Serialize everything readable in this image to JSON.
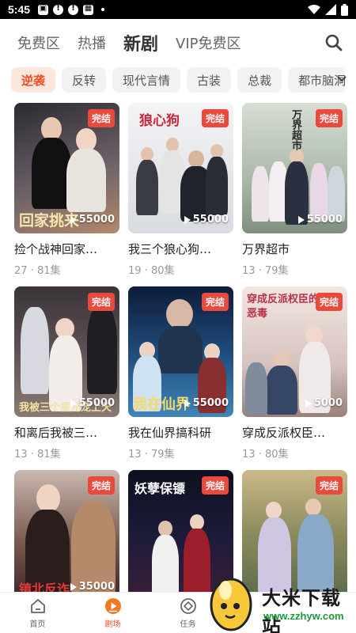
{
  "status": {
    "time": "5:45",
    "icons": [
      "photo-icon",
      "alert-icon",
      "alert-icon",
      "media-icon"
    ],
    "right_icons": [
      "wifi-icon",
      "signal-icon",
      "battery-icon"
    ]
  },
  "tabs": [
    {
      "label": "免费区",
      "active": false
    },
    {
      "label": "热播",
      "active": false
    },
    {
      "label": "新剧",
      "active": true
    },
    {
      "label": "VIP免费区",
      "active": false
    }
  ],
  "chips": [
    "逆袭",
    "反转",
    "现代言情",
    "古装",
    "总裁",
    "都市脑洞"
  ],
  "chips_active_index": 0,
  "colors": {
    "accent": "#f04e23",
    "badge": "#e94a3b",
    "chip_active_bg": "#fde6dc"
  },
  "dramas": [
    {
      "title": "捡个战神回家…",
      "badge": "完结",
      "plays": "55000",
      "views": "27",
      "episodes": "81集",
      "poster_text": "回家挑来"
    },
    {
      "title": "我三个狼心狗…",
      "badge": "完结",
      "plays": "55000",
      "views": "19",
      "episodes": "80集",
      "poster_text": "狼心狗"
    },
    {
      "title": "万界超市",
      "badge": "完结",
      "plays": "55000",
      "views": "13",
      "episodes": "79集",
      "poster_text": "万界超市"
    },
    {
      "title": "和离后我被三…",
      "badge": "完结",
      "plays": "55000",
      "views": "13",
      "episodes": "81集",
      "poster_text": "我被三个皇兄宠上天"
    },
    {
      "title": "我在仙界搞科研",
      "badge": "完结",
      "plays": "55000",
      "views": "13",
      "episodes": "79集",
      "poster_text": "我在仙界"
    },
    {
      "title": "穿成反派权臣…",
      "badge": "完结",
      "plays": "5000",
      "views": "13",
      "episodes": "80集",
      "poster_text": "穿成反派权臣的恶毒"
    },
    {
      "title": "",
      "badge": "完结",
      "plays": "35000",
      "views": "",
      "episodes": "",
      "poster_text": "镇北反诈"
    },
    {
      "title": "",
      "badge": "完结",
      "plays": "",
      "views": "",
      "episodes": "",
      "poster_text": "妖孽保镖"
    },
    {
      "title": "",
      "badge": "完结",
      "plays": "",
      "views": "",
      "episodes": "",
      "poster_text": ""
    }
  ],
  "bottom_nav": [
    {
      "label": "首页",
      "icon": "home-icon",
      "active": false
    },
    {
      "label": "剧场",
      "icon": "theater-play-icon",
      "active": true
    },
    {
      "label": "任务",
      "icon": "task-icon",
      "active": false
    }
  ],
  "watermark": {
    "title": "大米下载站",
    "url": "www.zzhyw.com"
  }
}
